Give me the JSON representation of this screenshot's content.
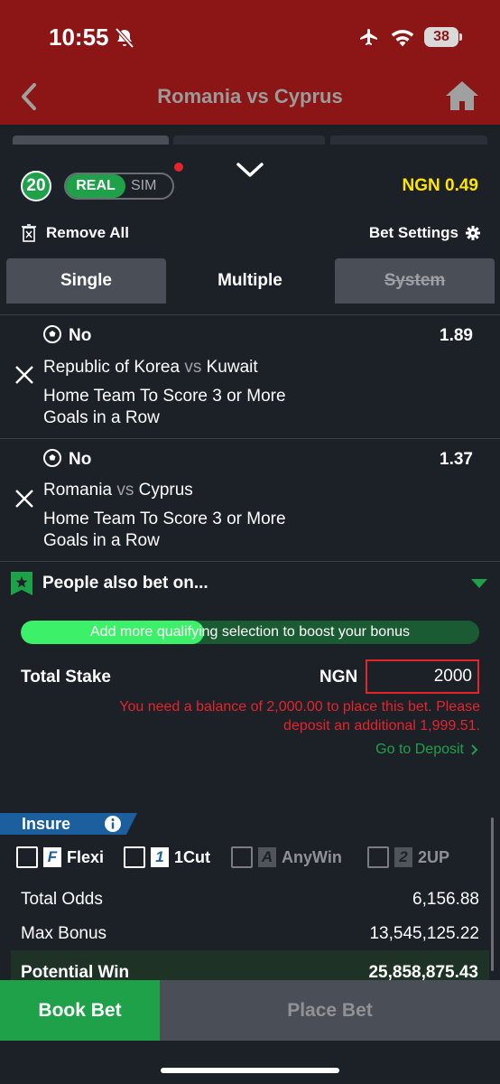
{
  "status_bar": {
    "time": "10:55",
    "battery": "38"
  },
  "header": {
    "title": "Romania vs Cyprus"
  },
  "betslip": {
    "count": "20",
    "mode_real": "REAL",
    "mode_sim": "SIM",
    "balance": "NGN 0.49",
    "remove_all": "Remove All",
    "bet_settings": "Bet Settings"
  },
  "tabs": {
    "single": "Single",
    "multiple": "Multiple",
    "system": "System"
  },
  "selections": [
    {
      "pick": "No",
      "odds": "1.89",
      "home": "Republic of Korea",
      "vs": "vs",
      "away": "Kuwait",
      "market_line1": "Home Team To Score 3 or More",
      "market_line2": "Goals in a Row"
    },
    {
      "pick": "No",
      "odds": "1.37",
      "home": "Romania",
      "vs": "vs",
      "away": "Cyprus",
      "market_line1": "Home Team To Score 3 or More",
      "market_line2": "Goals in a Row"
    }
  ],
  "people_also_bet": "People also bet on...",
  "bonus": {
    "text": "Add more qualifying selection to boost your bonus",
    "progress": 0.4
  },
  "stake": {
    "label": "Total Stake",
    "currency": "NGN",
    "value": "2000",
    "error_line1": "You need a balance of 2,000.00 to place this bet. Please",
    "error_line2": "deposit an additional 1,999.51.",
    "deposit_link": "Go to Deposit"
  },
  "insure": {
    "title": "Insure",
    "options": [
      {
        "badge": "F",
        "label": "Flexi"
      },
      {
        "badge": "1",
        "label": "1Cut"
      },
      {
        "badge": "A",
        "label": "AnyWin"
      },
      {
        "badge": "2",
        "label": "2UP"
      }
    ]
  },
  "summary": {
    "total_odds_label": "Total Odds",
    "total_odds_value": "6,156.88",
    "max_bonus_label": "Max Bonus",
    "max_bonus_value": "13,545,125.22",
    "potential_win_label": "Potential Win",
    "potential_win_value": "25,858,875.43"
  },
  "actions": {
    "book_bet": "Book Bet",
    "place_bet": "Place Bet"
  },
  "colors": {
    "header": "#8c1515",
    "accent_green": "#1fa14a",
    "balance_yellow": "#ffe500",
    "error_red": "#e5242c"
  }
}
